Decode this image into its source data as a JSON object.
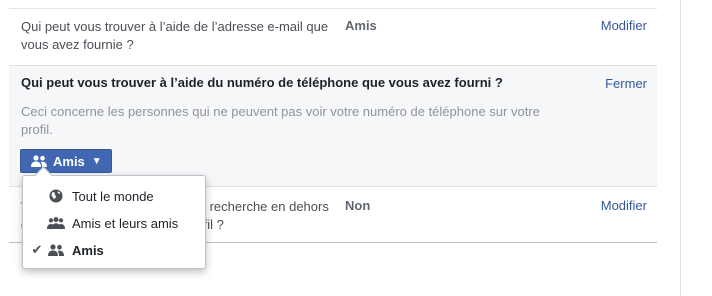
{
  "rows": [
    {
      "question": "Qui peut vous trouver à l’aide de l’adresse e-mail que vous avez fournie ?",
      "value": "Amis",
      "action": "Modifier"
    },
    {
      "question": "Qui peut vous trouver à l’aide du numéro de téléphone que vous avez fourni ?",
      "action": "Fermer",
      "description": "Ceci concerne les personnes qui ne peuvent pas voir votre numéro de téléphone sur votre profil.",
      "audience_button": "Amis"
    },
    {
      "question": "Voulez-vous que les moteurs de recherche en dehors de Facebook affichent votre profil ?",
      "value": "Non",
      "action": "Modifier"
    }
  ],
  "dropdown": {
    "selected": "Amis",
    "options": [
      {
        "label": "Tout le monde",
        "icon": "globe-icon"
      },
      {
        "label": "Amis et leurs amis",
        "icon": "friends-of-friends-icon"
      },
      {
        "label": "Amis",
        "icon": "friends-icon",
        "checked": true
      }
    ]
  },
  "colors": {
    "link": "#365899",
    "button": "#4267b2",
    "expanded_bg": "#f6f7f9"
  }
}
